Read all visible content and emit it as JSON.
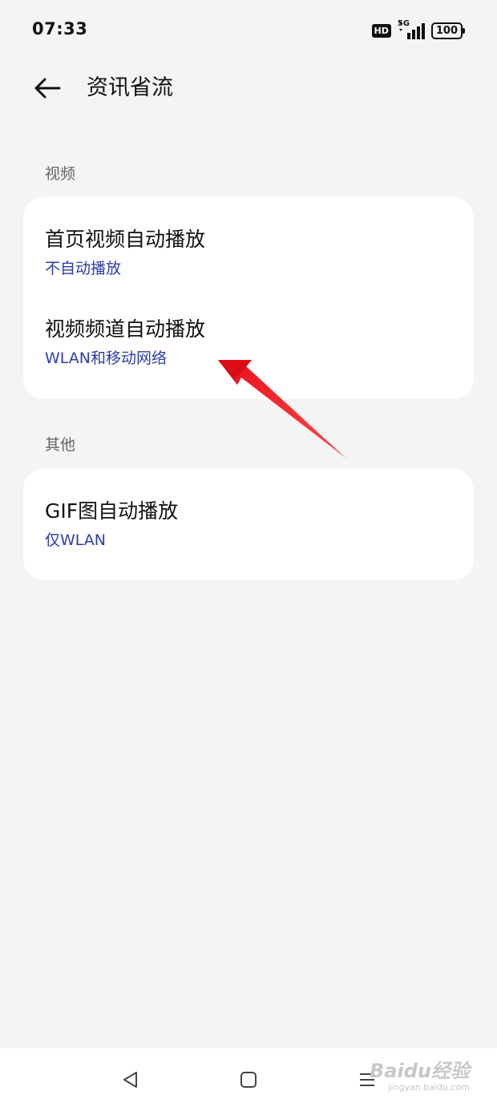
{
  "status_bar": {
    "time": "07:33",
    "hd_label": "HD",
    "network_label": "5G",
    "battery_level": "100"
  },
  "header": {
    "title": "资讯省流",
    "back_icon": "arrow-left-icon"
  },
  "sections": [
    {
      "label": "视频",
      "items": [
        {
          "title": "首页视频自动播放",
          "value": "不自动播放"
        },
        {
          "title": "视频频道自动播放",
          "value": "WLAN和移动网络"
        }
      ]
    },
    {
      "label": "其他",
      "items": [
        {
          "title": "GIF图自动播放",
          "value": "仅WLAN"
        }
      ]
    }
  ],
  "colors": {
    "background": "#f4f4f4",
    "card": "#ffffff",
    "accent_text": "#2d3dab",
    "annotation_arrow": "#e8101a"
  },
  "nav_bar": {
    "back_icon": "triangle-back-icon",
    "home_icon": "square-home-icon",
    "menu_icon": "hamburger-menu-icon"
  },
  "watermark": {
    "brand": "Baidu经验",
    "url": "jingyan.baidu.com"
  }
}
